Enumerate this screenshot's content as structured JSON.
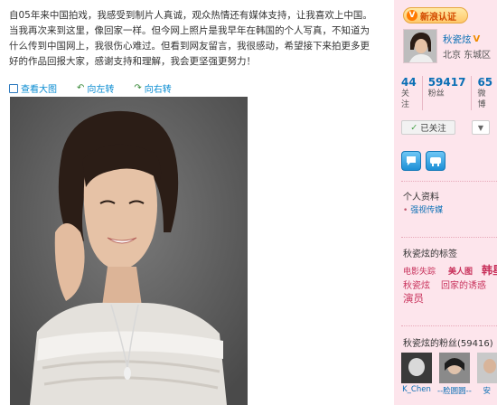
{
  "post": {
    "text": "自05年来中国拍戏，我感受到制片人真诚，观众热情还有媒体支持，让我喜欢上中国。当我再次来到这里，像回家一样。但今网上照片是我早年在韩国的个人写真，不知道为什么传到中国网上，我很伤心难过。但看到网友留言，我很感动，希望接下来拍更多更好的作品回报大家，感谢支持和理解，我会更坚强更努力！",
    "actions": {
      "view_large": "查看大图",
      "rotate_left": "向左转",
      "rotate_right": "向右转"
    }
  },
  "sidebar": {
    "badge": "新浪认证",
    "badge_mark": "V",
    "user_name": "秋瓷炫",
    "location": "北京  东城区",
    "stats": [
      {
        "num": "44",
        "label": "关注"
      },
      {
        "num": "59417",
        "label": "粉丝"
      },
      {
        "num": "65",
        "label": "微博"
      }
    ],
    "follow_button": "已关注",
    "profile_title": "个人资料",
    "profile_link": "强视传媒",
    "tags_title": "秋瓷炫的标签",
    "tags": [
      "电影失踪",
      "美人图",
      "韩星",
      "秋瓷炫",
      "回家的诱惑",
      "演员"
    ],
    "fans_title": "秋瓷炫的粉丝(59416)",
    "fans": [
      "K_Chen",
      "--脸圆圆--",
      "安"
    ]
  },
  "colors": {
    "sidebar_bg": "#fde5ec",
    "link_blue": "#0a6fb5",
    "tag_red": "#c8315b"
  }
}
